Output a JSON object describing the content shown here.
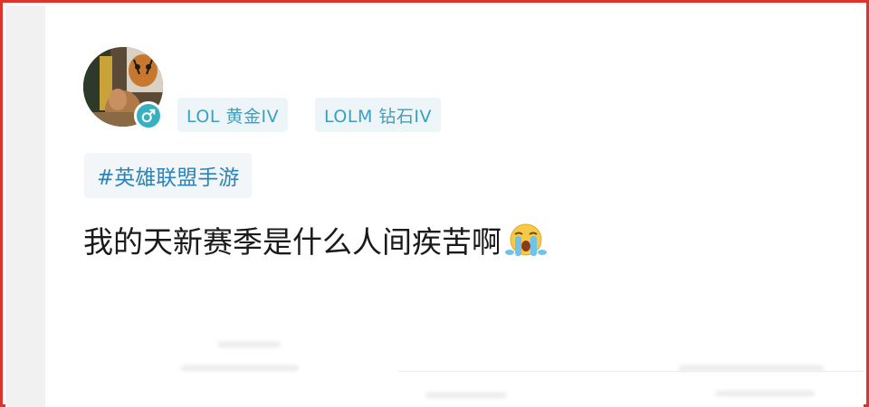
{
  "post": {
    "user": {
      "avatar": "avatar-image",
      "gender_icon": "male-icon"
    },
    "tags": [
      {
        "label": "LOL 黄金IV"
      },
      {
        "label": "LOLM 钻石IV"
      }
    ],
    "topic": "#英雄联盟手游",
    "content": "我的天新赛季是什么人间疾苦啊",
    "emoji": "crying-face-emoji"
  },
  "colors": {
    "frame_border": "#e0312b",
    "tag_text": "#3a9fc0",
    "tag_bg": "#eef5f8",
    "topic_text": "#2b84b8",
    "gender_badge": "#37b1c2"
  }
}
